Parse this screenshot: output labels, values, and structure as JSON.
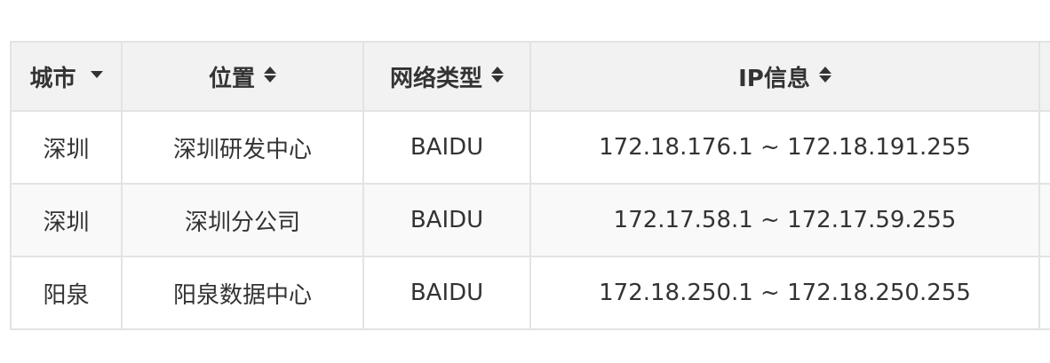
{
  "table": {
    "columns": [
      {
        "label": "城市",
        "sort_icon": "caret-down-icon"
      },
      {
        "label": "位置",
        "sort_icon": "sort-icon"
      },
      {
        "label": "网络类型",
        "sort_icon": "sort-icon"
      },
      {
        "label": "IP信息",
        "sort_icon": "sort-icon"
      },
      {
        "label": ""
      }
    ],
    "rows": [
      {
        "city": "深圳",
        "location": "深圳研发中心",
        "network": "BAIDU",
        "ip": "172.18.176.1 ~ 172.18.191.255"
      },
      {
        "city": "深圳",
        "location": "深圳分公司",
        "network": "BAIDU",
        "ip": "172.17.58.1 ~ 172.17.59.255"
      },
      {
        "city": "阳泉",
        "location": "阳泉数据中心",
        "network": "BAIDU",
        "ip": "172.18.250.1 ~ 172.18.250.255"
      }
    ]
  },
  "colors": {
    "header_bg": "#f2f2f2",
    "row_alt_bg": "#f9f9f9",
    "border": "#e3e3e3",
    "text": "#333333"
  }
}
